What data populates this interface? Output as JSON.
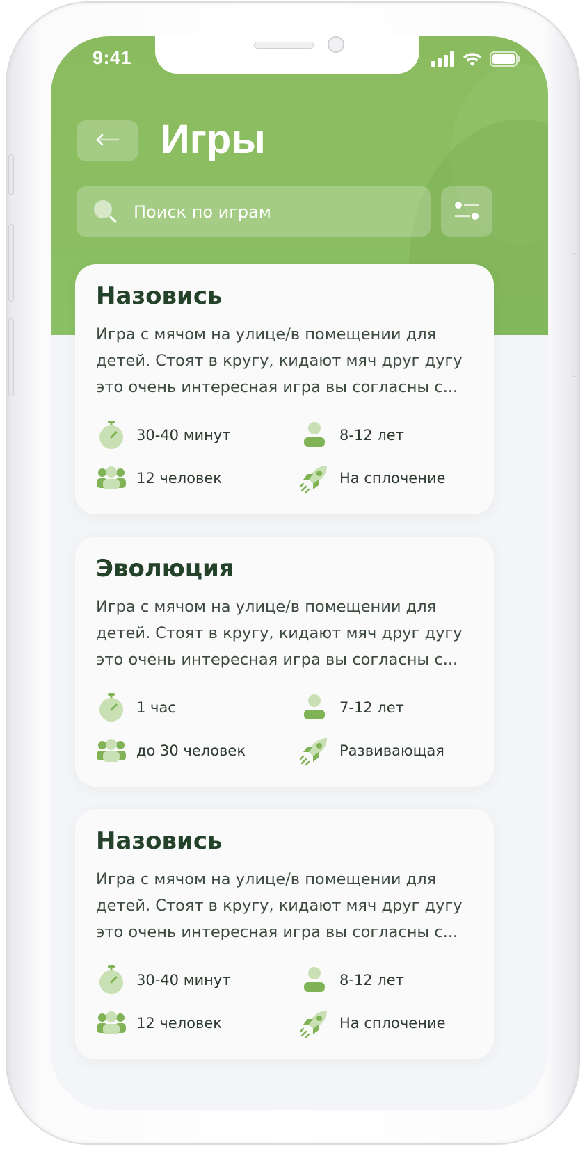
{
  "status_bar": {
    "time": "9:41",
    "icons": [
      "signal-icon",
      "wifi-icon",
      "battery-icon"
    ]
  },
  "header": {
    "back_icon": "arrow-left-icon",
    "title": "Игры",
    "search": {
      "placeholder": "Поиск по играм",
      "value": "",
      "icon": "search-icon"
    },
    "filter_icon": "filter-icon"
  },
  "colors": {
    "header_green": "#8bbb5f",
    "icon_green": "#7fb356",
    "icon_green_light": "#c9e0b4",
    "title_dark_green": "#24422a",
    "card_bg": "#fafafa",
    "screen_bg": "#f4f5f8"
  },
  "games": [
    {
      "title": "Назовись",
      "description": "Игра с мячом на улице/в помещении для детей. Стоят в кругу, кидают мяч друг дугу это очень интересная игра вы согласны с...",
      "duration": "30-40 минут",
      "age": "8-12 лет",
      "players": "12 человек",
      "category": "На сплочение"
    },
    {
      "title": "Эволюция",
      "description": "Игра с мячом на улице/в помещении для детей. Стоят в кругу, кидают мяч друг дугу это очень интересная игра вы согласны с...",
      "duration": "1 час",
      "age": "7-12 лет",
      "players": "до 30 человек",
      "category": "Развивающая"
    },
    {
      "title": "Назовись",
      "description": "Игра с мячом на улице/в помещении для детей. Стоят в кругу, кидают мяч друг дугу это очень интересная игра вы согласны с...",
      "duration": "30-40 минут",
      "age": "8-12 лет",
      "players": "12 человек",
      "category": "На сплочение"
    }
  ]
}
